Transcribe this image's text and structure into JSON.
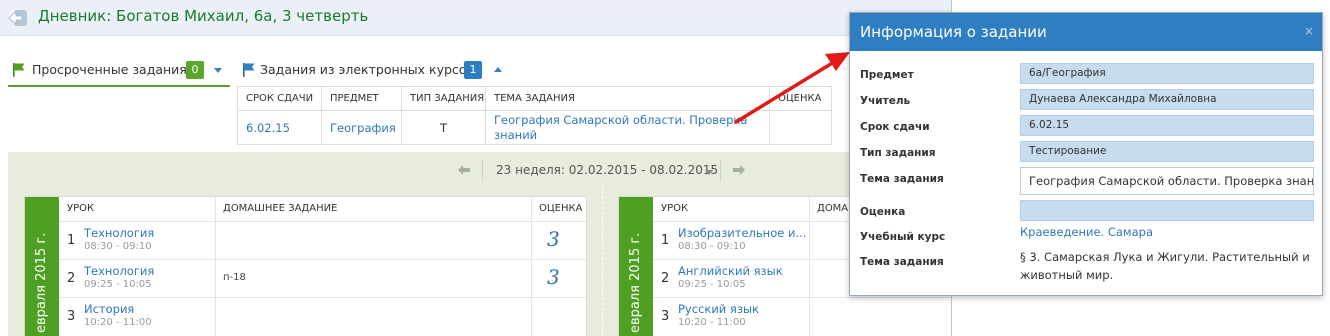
{
  "header": {
    "title": "Дневник: Богатов Михаил, 6а, 3 четверть"
  },
  "tabs": [
    {
      "label": "Просроченные задания",
      "count": "0"
    },
    {
      "label": "Задания из электронных курсов",
      "count": "1"
    }
  ],
  "assignments_table": {
    "columns": [
      "СРОК СДАЧИ",
      "ПРЕДМЕТ",
      "ТИП ЗАДАНИЯ",
      "ТЕМА ЗАДАНИЯ",
      "ОЦЕНКА"
    ],
    "rows": [
      {
        "due": "6.02.15",
        "subject": "География",
        "type": "Т",
        "topic": "География Самарской области. Проверка знаний",
        "grade": ""
      }
    ]
  },
  "week_nav": {
    "label": "23 неделя: 02.02.2015 - 08.02.2015"
  },
  "day_left": {
    "strip_label": "евраля 2015 г.",
    "columns": [
      "УРОК",
      "ДОМАШНЕЕ ЗАДАНИЕ",
      "ОЦЕНКА"
    ],
    "lessons": [
      {
        "num": "1",
        "name": "Технология",
        "time": "08:30 - 09:10",
        "homework": "",
        "grade": "3"
      },
      {
        "num": "2",
        "name": "Технология",
        "time": "09:25 - 10:05",
        "homework": "п-18",
        "grade": "3"
      },
      {
        "num": "3",
        "name": "История",
        "time": "10:20 - 11:00",
        "homework": "",
        "grade": ""
      }
    ]
  },
  "day_right": {
    "strip_label": "евраля 2015 г.",
    "columns": [
      "УРОК",
      "ДОМА"
    ],
    "lessons": [
      {
        "num": "1",
        "name": "Изобразительное и...",
        "time": "08:30 - 09:10"
      },
      {
        "num": "2",
        "name": "Английский язык",
        "time": "09:25 - 10:05"
      },
      {
        "num": "3",
        "name": "Русский язык",
        "time": "10:20 - 11:00"
      }
    ]
  },
  "popup": {
    "title": "Информация о задании",
    "close": "×",
    "fields": {
      "subject_label": "Предмет",
      "subject_value": "6а/География",
      "teacher_label": "Учитель",
      "teacher_value": "Дунаева Александра Михайловна",
      "due_label": "Срок сдачи",
      "due_value": "6.02.15",
      "type_label": "Тип задания",
      "type_value": "Тестирование",
      "topic_label": "Тема задания",
      "topic_value": "География Самарской области. Проверка знаний",
      "grade_label": "Оценка",
      "grade_value": "",
      "course_label": "Учебный курс",
      "course_value": "Краеведение. Самара",
      "topic2_label": "Тема задания",
      "topic2_value": "§ 3. Самарская Лука и Жигули. Растительный и животный мир."
    }
  },
  "colors": {
    "accent_blue": "#2f7ec2",
    "accent_green": "#4e9f22",
    "title_green": "#1a7a2e",
    "arrow_red": "#e11b1b"
  }
}
